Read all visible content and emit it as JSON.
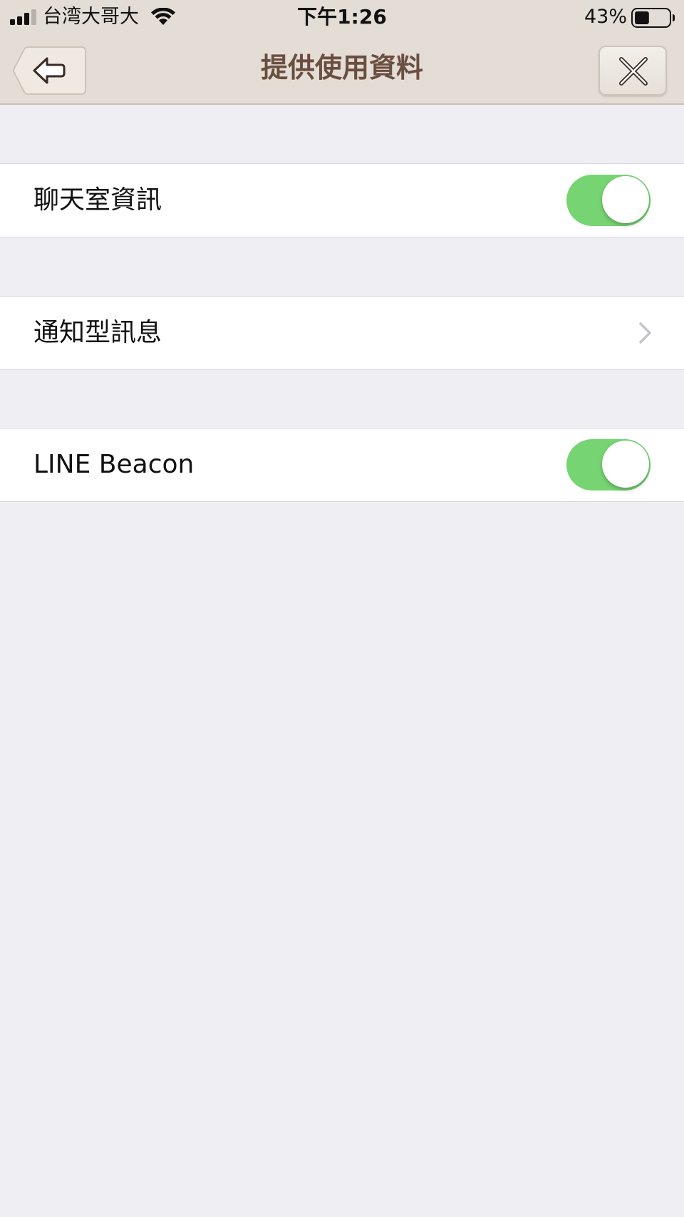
{
  "status_bar": {
    "carrier": "台湾大哥大",
    "time": "下午1:26",
    "battery_percent": "43%",
    "battery_level": 0.43,
    "signal_icon": "cellular-signal-icon",
    "wifi_icon": "wifi-icon",
    "battery_icon": "battery-icon"
  },
  "nav": {
    "title": "提供使用資料",
    "back_icon": "back-arrow-icon",
    "close_icon": "close-icon"
  },
  "settings": {
    "chat_info": {
      "label": "聊天室資訊",
      "enabled": true
    },
    "notification_messages": {
      "label": "通知型訊息",
      "icon": "chevron-right-icon"
    },
    "line_beacon": {
      "label": "LINE Beacon",
      "enabled": true
    }
  },
  "colors": {
    "nav_background": "#e3ddd5",
    "title_color": "#6a4e40",
    "toggle_on": "#76d572",
    "page_background": "#efeef3"
  }
}
